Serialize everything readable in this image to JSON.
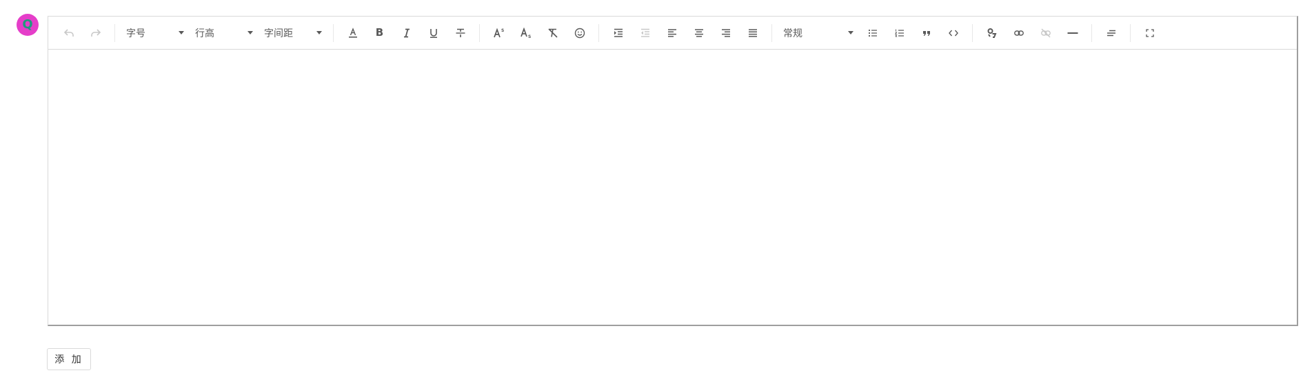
{
  "avatar": {
    "letter": "Q",
    "color": "#e53ec9"
  },
  "toolbar": {
    "font_size_label": "字号",
    "line_height_label": "行高",
    "letter_spacing_label": "字间距",
    "heading_label": "常规",
    "icons": [
      "undo-icon",
      "redo-icon",
      "text-color-icon",
      "bold-icon",
      "italic-icon",
      "underline-icon",
      "strikethrough-icon",
      "superscript-icon",
      "subscript-icon",
      "clear-format-icon",
      "emoji-icon",
      "indent-increase-icon",
      "indent-decrease-icon",
      "align-left-icon",
      "align-center-icon",
      "align-right-icon",
      "align-justify-icon",
      "bullet-list-icon",
      "numbered-list-icon",
      "blockquote-icon",
      "code-icon",
      "media-icon",
      "link-icon",
      "unlink-icon",
      "horizontal-rule-icon",
      "text-indent-icon",
      "fullscreen-icon"
    ]
  },
  "editor": {
    "content": ""
  },
  "actions": {
    "add_label": "添 加"
  }
}
